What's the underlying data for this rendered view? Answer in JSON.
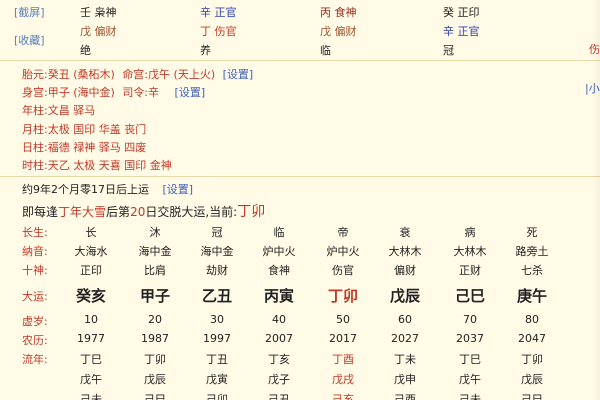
{
  "top_left_buttons": {
    "screenshot": "[截屏]",
    "favorite": "[收藏]"
  },
  "pillar_table": {
    "rows": [
      {
        "cells": [
          "壬 枭神",
          "辛 正官",
          "丙 食神",
          "癸 正印"
        ]
      },
      {
        "cells": [
          "戊 偏财",
          "丁 伤官",
          "戊 偏财",
          "辛 正官"
        ]
      },
      {
        "cells": [
          "绝",
          "养",
          "临",
          "冠"
        ]
      }
    ]
  },
  "right_edge_marks": [
    "伤",
    "|小"
  ],
  "info_lines": {
    "taiyuan_label": "胎元:",
    "taiyuan_value": "癸丑 (桑柘木)",
    "minggong_label": "命宫:",
    "minggong_value": "戊午 (天上火)",
    "setting_link": "[设置]",
    "shengong_label": "身宫:",
    "shengong_value": "甲子 (海中金)",
    "siling_label": "司令:",
    "siling_value": "辛",
    "setting_link_2": "[设置]",
    "year_label": "年柱:",
    "year_value": "文昌 驿马",
    "month_label": "月柱:",
    "month_value": "太极 国印 华盖 丧门",
    "day_label": "日柱:",
    "day_value": "福德 禄神 驿马 四废",
    "hour_label": "时柱:",
    "hour_value": "天乙 太极 天喜 国印 金神",
    "luck_start_text": "约9年2个月零17日后上运",
    "setting_link_3": "[设置]",
    "luck_change_text_1": "即每逢",
    "luck_change_year": "丁年",
    "luck_change_text_2": "大雪",
    "luck_change_text_3": "后第",
    "luck_change_days": "20",
    "luck_change_text_4": "日交脱大运,当前:",
    "luck_current": "丁卯"
  },
  "dayun_table": {
    "labels": {
      "changsheng": "长生:",
      "nayin": "纳音:",
      "shishen": "十神:",
      "dayun": "大运:",
      "xusui": "虚岁:",
      "nongli": "农历:",
      "liunian": "流年:"
    },
    "changsheng": [
      "长",
      "沐",
      "冠",
      "临",
      "帝",
      "衰",
      "病",
      "死"
    ],
    "nayin": [
      "大海水",
      "海中金",
      "海中金",
      "炉中火",
      "炉中火",
      "大林木",
      "大林木",
      "路旁土"
    ],
    "shishen": [
      "正印",
      "比肩",
      "劫财",
      "食神",
      "伤官",
      "偏财",
      "正财",
      "七杀"
    ],
    "dayun": [
      "癸亥",
      "甲子",
      "乙丑",
      "丙寅",
      "丁卯",
      "戊辰",
      "己巳",
      "庚午"
    ],
    "xusui": [
      "10",
      "20",
      "30",
      "40",
      "50",
      "60",
      "70",
      "80"
    ],
    "nongli": [
      "1977",
      "1987",
      "1997",
      "2007",
      "2017",
      "2027",
      "2037",
      "2047"
    ],
    "liunian_row1": [
      "丁巳",
      "丁卯",
      "丁丑",
      "丁亥",
      "丁酉",
      "丁未",
      "丁巳",
      "丁卯"
    ],
    "liunian_row2": [
      "戊午",
      "戊辰",
      "戊寅",
      "戊子",
      "戊戌",
      "戊申",
      "戊午",
      "戊辰"
    ],
    "liunian_row3": [
      "己未",
      "己巳",
      "己卯",
      "己丑",
      "己亥",
      "己酉",
      "己未",
      "己巳"
    ]
  },
  "colors": {
    "background": "#fffbe6",
    "label_red": "#c0392b",
    "link_blue": "#4060b8",
    "highlight": "#c0392b"
  }
}
